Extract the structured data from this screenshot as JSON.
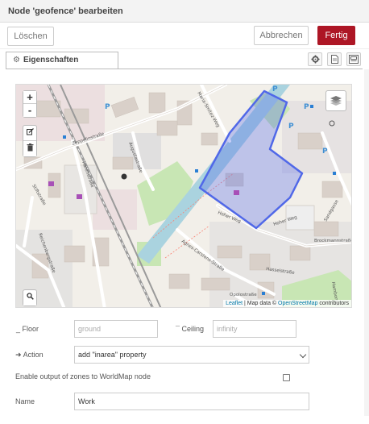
{
  "dialog": {
    "title": "Node 'geofence' bearbeiten"
  },
  "toolbar": {
    "delete_label": "Löschen",
    "cancel_label": "Abbrechen",
    "done_label": "Fertig"
  },
  "tabs": [
    {
      "label": "Eigenschaften",
      "icon": "cog-icon"
    }
  ],
  "tab_icons": [
    "settings-icon",
    "description-icon",
    "appearance-icon"
  ],
  "map": {
    "controls": {
      "zoom_in": "+",
      "zoom_out": "-",
      "edit_icon": "pencil-icon",
      "delete_icon": "trash-icon",
      "search_icon": "search-icon",
      "layers_icon": "layers-icon"
    },
    "attribution": {
      "leaflet": "Leaflet",
      "separator": " | Map data © ",
      "osm": "OpenStreetMap",
      "suffix": " contributors"
    },
    "geofence_color": "#5068e8"
  },
  "form": {
    "floor": {
      "label": "Floor",
      "placeholder": "ground"
    },
    "ceiling": {
      "label": "Ceiling",
      "placeholder": "infinity"
    },
    "action": {
      "label": "Action",
      "value": "add \"inarea\" property",
      "icon": "sign-in-icon"
    },
    "worldmap": {
      "label": "Enable output of zones to WorldMap node",
      "checked": false
    },
    "name": {
      "label": "Name",
      "value": "Work"
    }
  }
}
